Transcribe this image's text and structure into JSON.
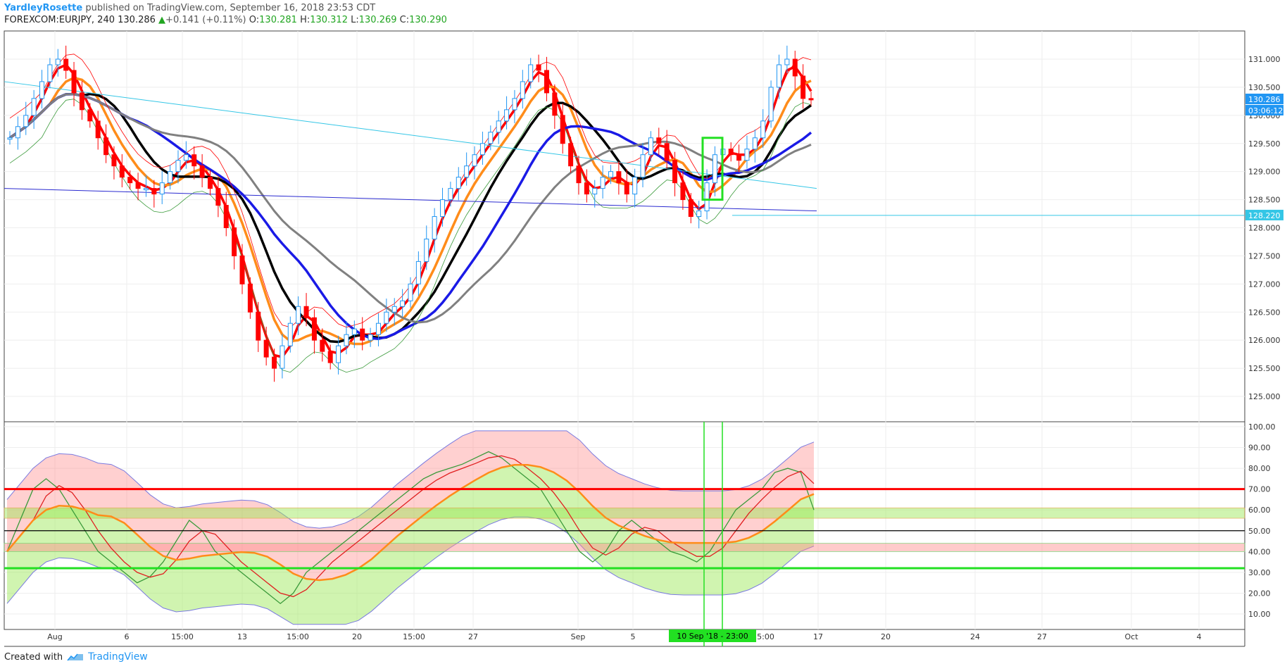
{
  "header": {
    "author": "YardleyRosette",
    "published_text": "published on TradingView.com, September 16, 2018 23:53 CDT",
    "symbol": "FOREXCOM:EURJPY, 240",
    "last": "130.286",
    "change_arrow": "▲",
    "change": "+0.141 (+0.11%)",
    "o_label": "O:",
    "o_value": "130.281",
    "h_label": "H:",
    "h_value": "130.312",
    "l_label": "L:",
    "l_value": "130.269",
    "c_label": "C:",
    "c_value": "130.290"
  },
  "price_axis": {
    "ticks": [
      "131.000",
      "130.500",
      "130.000",
      "129.500",
      "129.000",
      "128.500",
      "128.000",
      "127.500",
      "127.000",
      "126.500",
      "126.000",
      "125.500",
      "125.000"
    ],
    "current_price_label": "130.286",
    "countdown_label": "03:06:12",
    "hline_label": "128.220"
  },
  "osc_axis": {
    "ticks": [
      "100.00",
      "90.00",
      "80.00",
      "70.00",
      "60.00",
      "50.00",
      "40.00",
      "30.00",
      "20.00",
      "10.00"
    ]
  },
  "time_axis": {
    "labels": [
      "Aug",
      "6",
      "15:00",
      "13",
      "15:00",
      "20",
      "15:00",
      "27",
      "Sep",
      "5",
      "15:00",
      "17",
      "20",
      "24",
      "27",
      "Oct",
      "4"
    ],
    "crosshair_label": "10 Sep '18 - 23:00"
  },
  "footer": {
    "created_with": "Created with",
    "brand": "TradingView"
  },
  "colors": {
    "up_candle": "#2196f3",
    "down_candle": "#ff0000",
    "red_ma": "#ff0000",
    "orange_ma": "#ff8c1a",
    "black_ma": "#000000",
    "blue_ma": "#1a1ae6",
    "grey_ma": "#808080",
    "hline_cyan": "#34c6e6",
    "osc_red_line": "#ff0000",
    "osc_green_line": "#22e022",
    "highlight_green": "#22e022"
  },
  "chart_data": {
    "type": "candlestick",
    "symbol": "EURJPY",
    "interval": "240",
    "ylim": [
      124.7,
      131.5
    ],
    "hline": 128.22,
    "candles_approx_close": [
      129.6,
      129.8,
      130.0,
      130.3,
      130.6,
      130.9,
      131.0,
      130.8,
      130.4,
      130.1,
      129.9,
      129.6,
      129.3,
      129.1,
      128.9,
      128.8,
      128.7,
      128.7,
      128.6,
      128.8,
      129.0,
      129.2,
      129.3,
      129.1,
      128.9,
      128.7,
      128.4,
      128.0,
      127.5,
      127.0,
      126.5,
      126.0,
      125.7,
      125.5,
      125.9,
      126.3,
      126.6,
      126.4,
      126.0,
      125.8,
      125.6,
      125.9,
      126.1,
      126.2,
      126.0,
      126.1,
      126.3,
      126.5,
      126.6,
      126.7,
      127.0,
      127.4,
      127.8,
      128.2,
      128.5,
      128.7,
      128.9,
      129.1,
      129.3,
      129.5,
      129.7,
      129.9,
      130.1,
      130.3,
      130.6,
      130.9,
      130.8,
      130.4,
      130.0,
      129.5,
      129.1,
      128.8,
      128.6,
      128.7,
      128.9,
      129.0,
      128.8,
      128.6,
      128.9,
      129.3,
      129.6,
      129.5,
      129.2,
      128.8,
      128.5,
      128.2,
      128.3,
      128.8,
      129.3,
      129.4,
      129.3,
      129.2,
      129.4,
      129.6,
      129.9,
      130.5,
      130.9,
      131.0,
      130.7,
      130.3,
      130.29
    ],
    "oscillator": {
      "ylim": [
        0,
        100
      ],
      "levels": [
        70,
        50,
        32
      ],
      "rsi_approx": [
        40,
        55,
        70,
        75,
        70,
        60,
        50,
        40,
        35,
        30,
        25,
        28,
        35,
        45,
        55,
        50,
        40,
        35,
        30,
        25,
        20,
        15,
        20,
        30,
        35,
        40,
        45,
        50,
        55,
        60,
        65,
        70,
        75,
        78,
        80,
        82,
        85,
        88,
        85,
        80,
        75,
        70,
        60,
        50,
        40,
        35,
        40,
        50,
        55,
        50,
        45,
        40,
        38,
        35,
        40,
        50,
        60,
        65,
        70,
        78,
        80,
        78,
        60
      ]
    },
    "time_labels": [
      "Aug",
      "6",
      "15:00",
      "13",
      "15:00",
      "20",
      "15:00",
      "27",
      "Sep",
      "5",
      "15:00",
      "17",
      "20",
      "24",
      "27",
      "Oct",
      "4"
    ]
  }
}
